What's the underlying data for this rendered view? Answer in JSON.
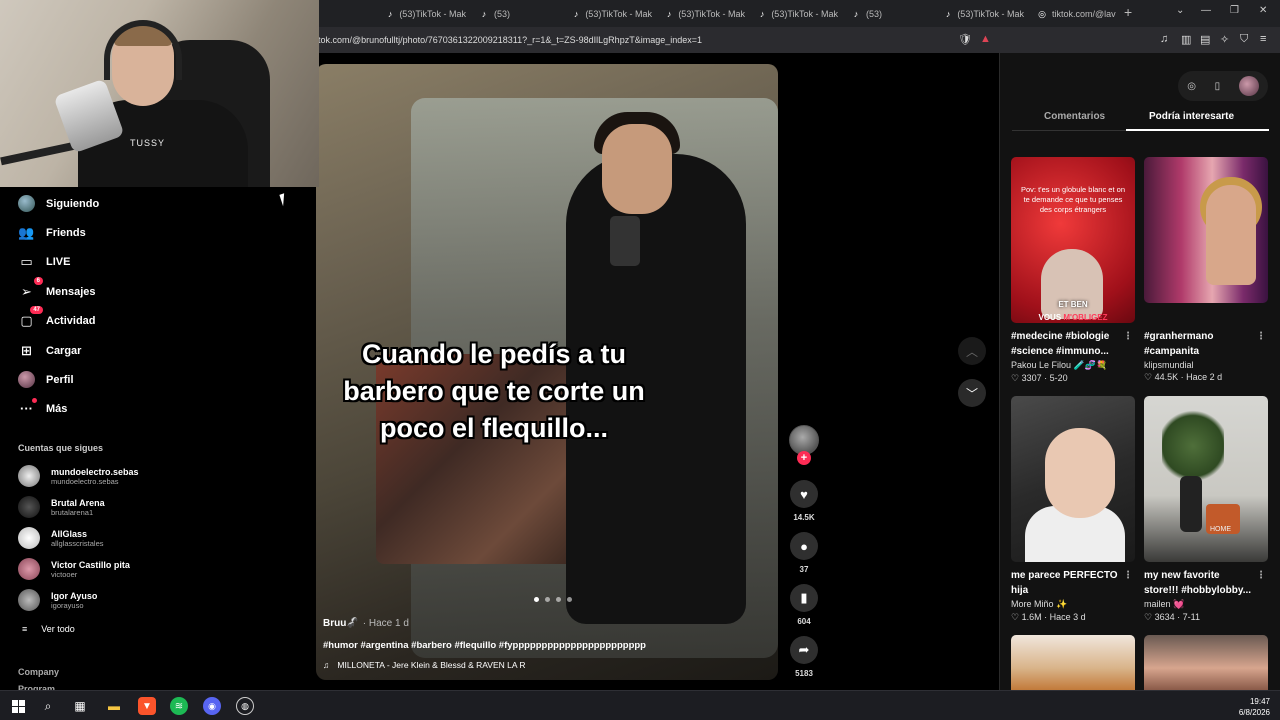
{
  "browser": {
    "tabs": [
      {
        "label": "(53)TikTok - Mak",
        "icon": "tiktok-icon"
      },
      {
        "label": "(53)",
        "icon": "tiktok-icon"
      },
      {
        "label": "(53)TikTok - Mak",
        "icon": "tiktok-icon"
      },
      {
        "label": "(53)TikTok - Mak",
        "icon": "tiktok-icon"
      },
      {
        "label": "(53)TikTok - Mak",
        "icon": "tiktok-icon"
      },
      {
        "label": "(53)",
        "icon": "tiktok-icon"
      },
      {
        "label": "(53)TikTok - Mak",
        "icon": "tiktok-icon"
      },
      {
        "label": "tiktok.com/@lav",
        "icon": "globe-icon"
      }
    ],
    "url": "tok.com/@brunofulltj/photo/7670361322009218311?_r=1&_t=ZS-98dIlLgRhpzT&image_index=1"
  },
  "webcam": {
    "shirt_text": "TUSSY"
  },
  "sidebar": {
    "nav": [
      {
        "label": "Siguiendo",
        "icon": "following-avatar-icon"
      },
      {
        "label": "Friends",
        "icon": "friends-icon"
      },
      {
        "label": "LIVE",
        "icon": "live-icon"
      },
      {
        "label": "Mensajes",
        "icon": "messages-icon",
        "badge": "6"
      },
      {
        "label": "Actividad",
        "icon": "activity-icon",
        "badge": "47"
      },
      {
        "label": "Cargar",
        "icon": "upload-icon"
      },
      {
        "label": "Perfil",
        "icon": "profile-avatar-icon"
      },
      {
        "label": "Más",
        "icon": "more-icon"
      }
    ],
    "following_title": "Cuentas que sigues",
    "following": [
      {
        "name": "mundoelectro.sebas",
        "handle": "mundoelectro.sebas"
      },
      {
        "name": "Brutal Arena",
        "handle": "brutalarena1"
      },
      {
        "name": "AllGlass",
        "handle": "allglasscristales"
      },
      {
        "name": "Victor Castillo pita",
        "handle": "victooer"
      },
      {
        "name": "Igor Ayuso",
        "handle": "igorayuso"
      }
    ],
    "see_all": "Ver todo",
    "company": "Company",
    "program": "Program"
  },
  "post": {
    "caption": "Cuando le pedís a tu barbero que te corte un poco el flequillo...",
    "author": "Bruu🦨",
    "ago": "· Hace 1 d",
    "hashtags": "#humor #argentina #barbero #flequillo #fyppppppppppppppppppppppp",
    "music": "MILLONETA - Jere Klein & Blessd & RAVEN LA R",
    "likes": "14.5K",
    "comments": "37",
    "saves": "604",
    "shares": "5183",
    "image_count": 4,
    "current_image": 1
  },
  "right_panel": {
    "tabs": {
      "comments": "Comentarios",
      "suggested": "Podría interesarte"
    },
    "cards": [
      {
        "title": "#medecine #biologie #science #immuno...",
        "author": "Pakou Le Filou 🧪🧬💐",
        "likes": "3307",
        "date": "5-20",
        "thumb_text": "Pov: t'es un globule blanc et on te demande ce que tu penses des corps étrangers",
        "thumb_cap1": "ET BEN",
        "thumb_cap2a": "VOUS ",
        "thumb_cap2b": "M'OBLIGEZ"
      },
      {
        "title": "#granhermano #campanita",
        "author": "klipsmundial",
        "likes": "44.5K",
        "date": "Hace 2 d"
      },
      {
        "title": "me parece PERFECTO hija",
        "author": "More Miño ✨",
        "likes": "1.6M",
        "date": "Hace 3 d"
      },
      {
        "title": "my new favorite store!!! #hobbylobby...",
        "author": "mailen 💓",
        "likes": "3634",
        "date": "7-11",
        "thumb_text": "HOME"
      }
    ]
  },
  "taskbar": {
    "time": "19:47",
    "date": "6/8/2026"
  }
}
